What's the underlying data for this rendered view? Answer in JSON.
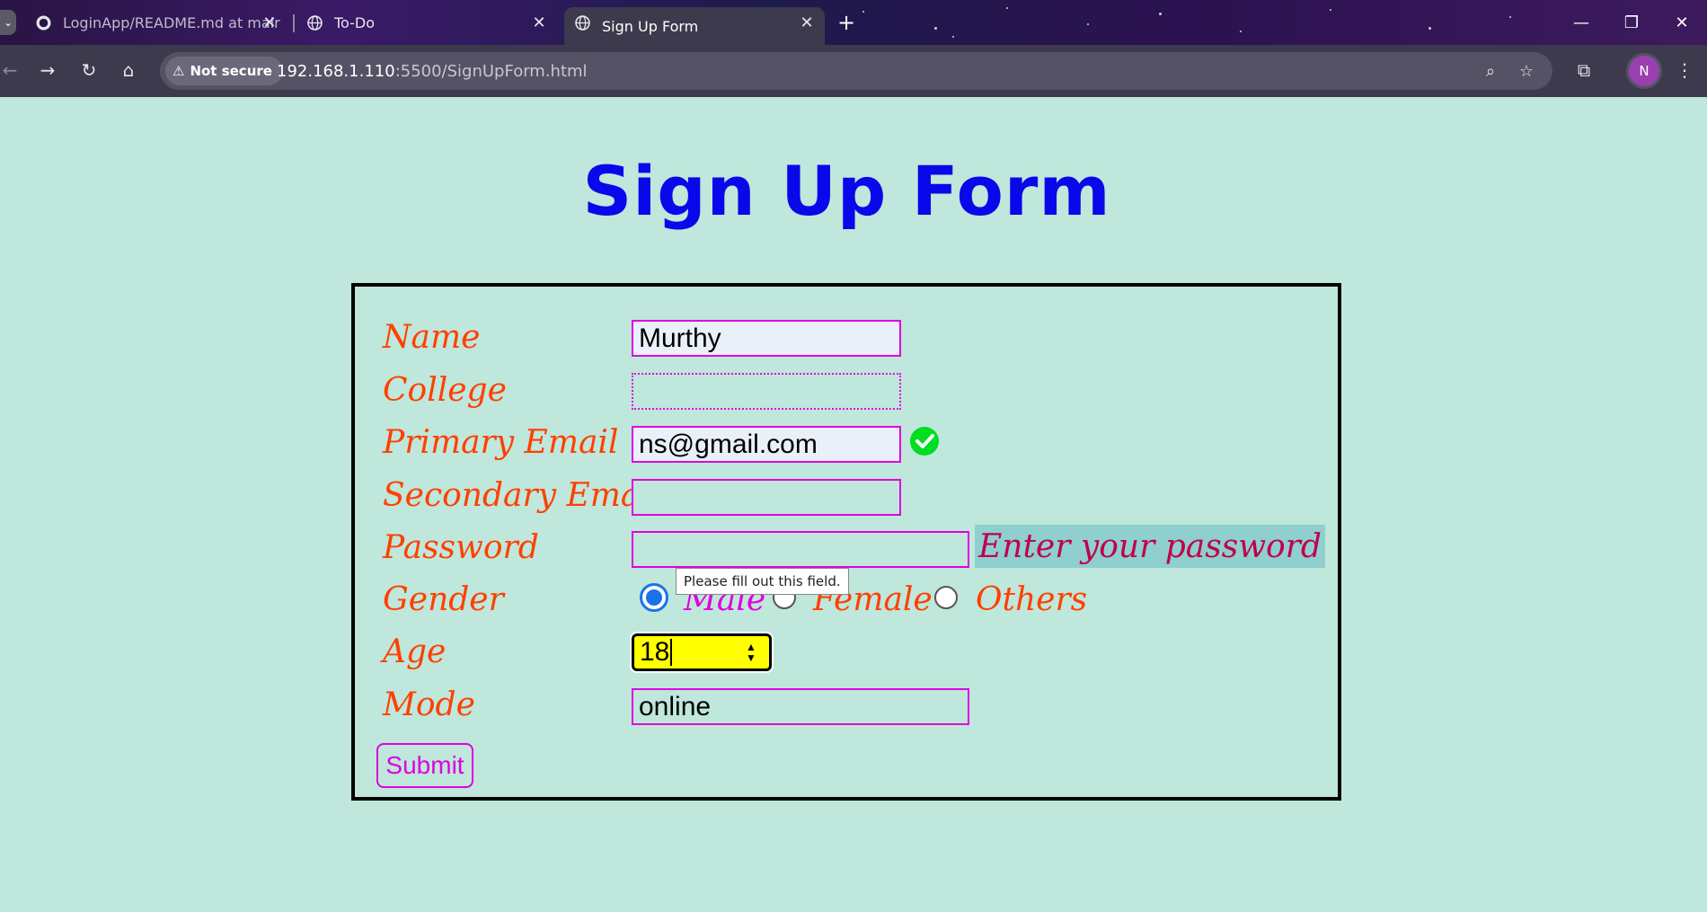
{
  "browser": {
    "tabs": [
      {
        "title": "LoginApp/README.md at mair",
        "active": false
      },
      {
        "title": "To-Do",
        "active": false
      },
      {
        "title": "Sign Up Form",
        "active": true
      }
    ],
    "security_chip": "Not secure",
    "url_host": "192.168.1.110",
    "url_path": ":5500/SignUpForm.html",
    "avatar_initial": "N"
  },
  "page": {
    "title": "Sign Up Form"
  },
  "form": {
    "name_label": "Name",
    "name_value": "Murthy",
    "college_label": "College",
    "college_value": "",
    "primary_email_label": "Primary Email",
    "primary_email_value": "ns@gmail.com",
    "secondary_email_label": "Secondary Email",
    "secondary_email_value": "",
    "password_label": "Password",
    "password_value": "",
    "password_hint": "Enter your password",
    "validation_tooltip": "Please fill out this field.",
    "gender_label": "Gender",
    "gender_options": [
      {
        "label": "Male",
        "checked": true
      },
      {
        "label": "Female",
        "checked": false
      },
      {
        "label": "Others",
        "checked": false
      }
    ],
    "age_label": "Age",
    "age_value": "18",
    "mode_label": "Mode",
    "mode_value": "online",
    "submit_label": "Submit"
  },
  "colors": {
    "page_bg": "#bfe7db",
    "title": "#0a07ea",
    "label": "#ff4000",
    "field_border": "#e000e0",
    "hint_bg": "#8fcfcf",
    "hint_text": "#c0004a",
    "age_bg": "#ffff00",
    "check": "#00dd22"
  },
  "icons": [
    "tab-list-icon",
    "github-icon",
    "globe-icon",
    "close-icon",
    "plus-icon",
    "minimize-icon",
    "restore-icon",
    "back-icon",
    "forward-icon",
    "reload-icon",
    "home-icon",
    "warning-icon",
    "zoom-icon",
    "star-icon",
    "extensions-icon",
    "more-icon",
    "check-circle-icon"
  ]
}
